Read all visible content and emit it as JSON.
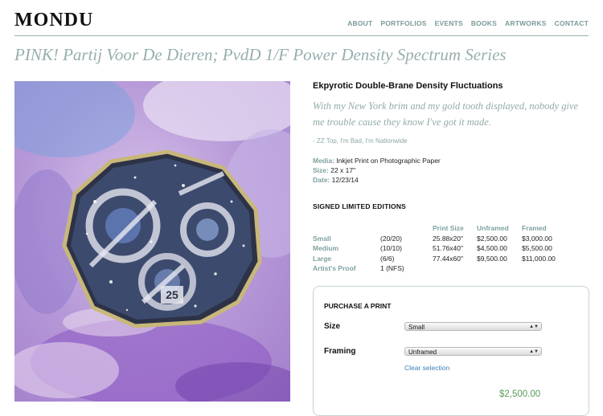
{
  "site": {
    "logo": "MONDU"
  },
  "nav": {
    "items": [
      "ABOUT",
      "PORTFOLIOS",
      "EVENTS",
      "BOOKS",
      "ARTWORKS",
      "CONTACT"
    ]
  },
  "page": {
    "title": "PINK! Partij Voor De Dieren; PvdD 1/F Power Density Spectrum Series"
  },
  "artwork": {
    "title": "Ekpyrotic Double-Brane Density Fluctuations",
    "quote": "With my New York brim and my gold tooth displayed, nobody give me trouble cause they know I've got it made.",
    "attribution": "- ZZ Top, I'm Bad, I'm Nationwide",
    "media_label": "Media:",
    "media": "Inkjet Print on Photographic Paper",
    "size_label": "Size:",
    "size": "22 x 17\"",
    "date_label": "Date:",
    "date": "12/23/14",
    "image_colors": [
      "#c9a6de",
      "#7d8fd0",
      "#8d5cc6",
      "#2d3246",
      "#b8a46a"
    ]
  },
  "editions": {
    "heading": "SIGNED LIMITED EDITIONS",
    "headers": [
      "Print Size",
      "Unframed",
      "Framed"
    ],
    "rows": [
      {
        "label": "Small",
        "count": "(20/20)",
        "size": "25.88x20\"",
        "unframed": "$2,500.00",
        "framed": "$3,000.00"
      },
      {
        "label": "Medium",
        "count": "(10/10)",
        "size": "51.76x40\"",
        "unframed": "$4,500.00",
        "framed": "$5,500.00"
      },
      {
        "label": "Large",
        "count": "(6/6)",
        "size": "77.44x60\"",
        "unframed": "$9,500.00",
        "framed": "$11,000.00"
      },
      {
        "label": "Artist's Proof",
        "count": "1 (NFS)",
        "size": "",
        "unframed": "",
        "framed": ""
      }
    ]
  },
  "purchase": {
    "heading": "PURCHASE A PRINT",
    "size_label": "Size",
    "size_value": "Small",
    "framing_label": "Framing",
    "framing_value": "Unframed",
    "clear_label": "Clear selection",
    "price": "$2,500.00"
  }
}
